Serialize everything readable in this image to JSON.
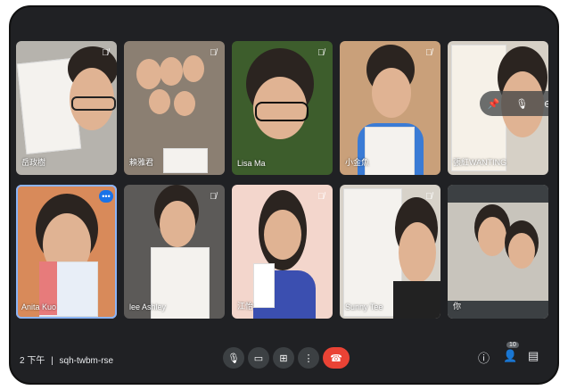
{
  "participants": [
    {
      "name": "岳政樹",
      "muted": true
    },
    {
      "name": "賴雅君",
      "muted": true
    },
    {
      "name": "Lisa Ma",
      "muted": true
    },
    {
      "name": "小金魚",
      "muted": true
    },
    {
      "name": "張紅WANTING",
      "muted": false,
      "overlay": true
    },
    {
      "name": "Anita Kuo",
      "muted": false,
      "active": true
    },
    {
      "name": "lee Ashley",
      "muted": true
    },
    {
      "name": "江怡",
      "muted": true
    },
    {
      "name": "Sunny Tee",
      "muted": true
    },
    {
      "name": "你",
      "muted": false
    }
  ],
  "meeting": {
    "time": "2 下午",
    "separator": "|",
    "code": "sqh-twbm-rse"
  },
  "controls": {
    "mic_icon": "mic-icon",
    "camera_icon": "camera-icon",
    "present_icon": "present-icon",
    "more_icon": "more-icon",
    "end_call_icon": "end-call-icon"
  },
  "right_controls": {
    "participant_count": "10"
  },
  "colors": {
    "background": "#202124",
    "tile": "#3c4043",
    "end_call": "#ea4335",
    "active_outline": "#8ab4f8"
  }
}
